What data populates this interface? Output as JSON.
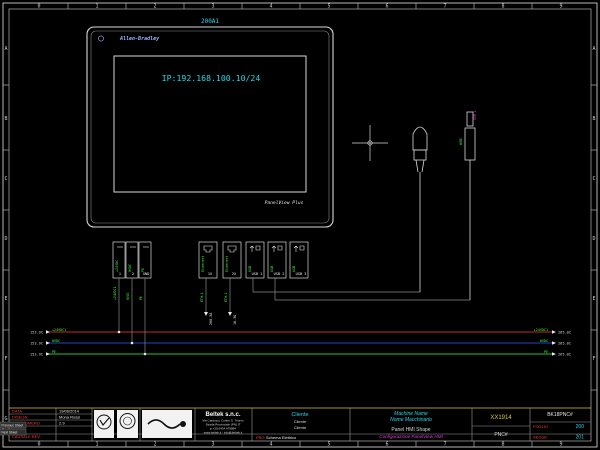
{
  "sheet": {
    "col_numbers": [
      "0",
      "1",
      "2",
      "3",
      "4",
      "5",
      "6",
      "7",
      "8",
      "9"
    ],
    "row_letters": [
      "A",
      "B",
      "C",
      "D",
      "E",
      "F",
      "G"
    ]
  },
  "device": {
    "tag": "200A1",
    "brand": "Allen-Bradley",
    "ip_text": "IP:192.168.100.10/24",
    "model": "PanelView Plus"
  },
  "connectors": [
    {
      "id": "c1",
      "label": "+24VDC",
      "pin": "1"
    },
    {
      "id": "c2",
      "label": "0VDC",
      "pin": "2"
    },
    {
      "id": "c3",
      "label": "PE",
      "pin": "GND"
    },
    {
      "id": "c4",
      "label": "Ethernet",
      "pin": "1X"
    },
    {
      "id": "c5",
      "label": "Ethernet",
      "pin": "2X"
    },
    {
      "id": "c6",
      "label": "USB",
      "pin": "USB 1"
    },
    {
      "id": "c7",
      "label": "USB",
      "pin": "USB 2"
    },
    {
      "id": "c8",
      "label": "USB",
      "pin": "USB 3"
    }
  ],
  "wire_labels": {
    "a": "+24VDC1",
    "b": "0VDC",
    "c": "PE",
    "d": "ETH-1",
    "e": "ETH-2",
    "ref_1": "208-3A",
    "ref_2": "16-3G"
  },
  "bus": {
    "left": [
      {
        "ref": "153.9C",
        "name": "+24VDC1",
        "color": "#ff3b3b"
      },
      {
        "ref": "153.9C",
        "name": "0VDC",
        "color": "#2f5bff"
      },
      {
        "ref": "153.9C",
        "name": "PE",
        "color": "#3cff3c"
      }
    ],
    "right": [
      {
        "ref": "265.0C",
        "name": "+24VDC1",
        "color": "#ff3b3b"
      },
      {
        "ref": "265.0C",
        "name": "0VDC",
        "color": "#2f5bff"
      },
      {
        "ref": "265.0C",
        "name": "PE",
        "color": "#3cff3c"
      }
    ]
  },
  "title_block": {
    "data_label": "DATA",
    "data_value": "19/06/2014",
    "dis_label": "DISEGN.",
    "dis_value": "Mona Rossi",
    "rev_label": "REV. NUMERO",
    "rev_value": "2.9",
    "app_label": "CAUSALE REV.",
    "side_tabs": [
      "Previous Sheet",
      "Next Sheet"
    ],
    "company": "Beltek s.n.c.",
    "address_1": "Via Carducci, Conter S. Trionio",
    "address_2": "Strada Provinciale (PN) IT",
    "address_3": "p.+39.0434.479884",
    "address_4": "www.beltek.it - info@beltek.it",
    "client_label": "Cliente",
    "client_1": "Cliente",
    "client_2": "Cliente",
    "prog_label": "PRG",
    "prog_value": "Schema Elettrico",
    "machine_label": "Machine Name",
    "machine_name": "Nome Macchinario",
    "sheet_title": "Panel HMI Shape",
    "sheet_subtitle": "Configurazione PanelView HMI",
    "code": "XX1914",
    "group": "PNC#",
    "code_right": "BK18PNC#",
    "sheet_label": "FOGLIO",
    "sheet_num": "200",
    "next_label": "SEGUE",
    "next_num": "201"
  },
  "colors": {
    "frame": "#cfcfcf",
    "dark_wire": "#8a8a8a",
    "accent_cyan": "#27d7e6",
    "accent_magenta": "#e235e2",
    "green": "#3cff3c",
    "red": "#ff3b3b",
    "blue": "#2f5bff",
    "title_yellow": "#d9c82e"
  },
  "icons": [
    "sheet-frame-icon",
    "hmi-panel-icon",
    "crosshair-icon",
    "rj45-plug-icon",
    "usb-plug-icon",
    "certification-logo-icon",
    "calibration-logo-icon",
    "beltek-logo-icon"
  ]
}
